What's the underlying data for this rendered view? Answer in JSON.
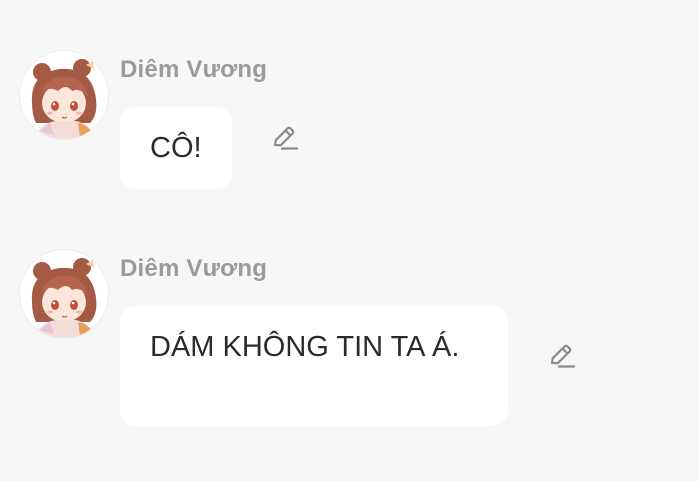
{
  "messages": [
    {
      "sender": "Diêm Vương",
      "text": "CÔ!",
      "avatar_icon": "anime-girl-avatar",
      "edit_icon": "pencil-edit-icon"
    },
    {
      "sender": "Diêm Vương",
      "text": "DÁM KHÔNG TIN TA Á.",
      "avatar_icon": "anime-girl-avatar",
      "edit_icon": "pencil-edit-icon"
    }
  ],
  "colors": {
    "background": "#f7f7f7",
    "bubble": "#ffffff",
    "sender_text": "#9a9a9a",
    "message_text": "#2b2b2b",
    "icon": "#8a8a8a",
    "hair": "#a45a44"
  }
}
